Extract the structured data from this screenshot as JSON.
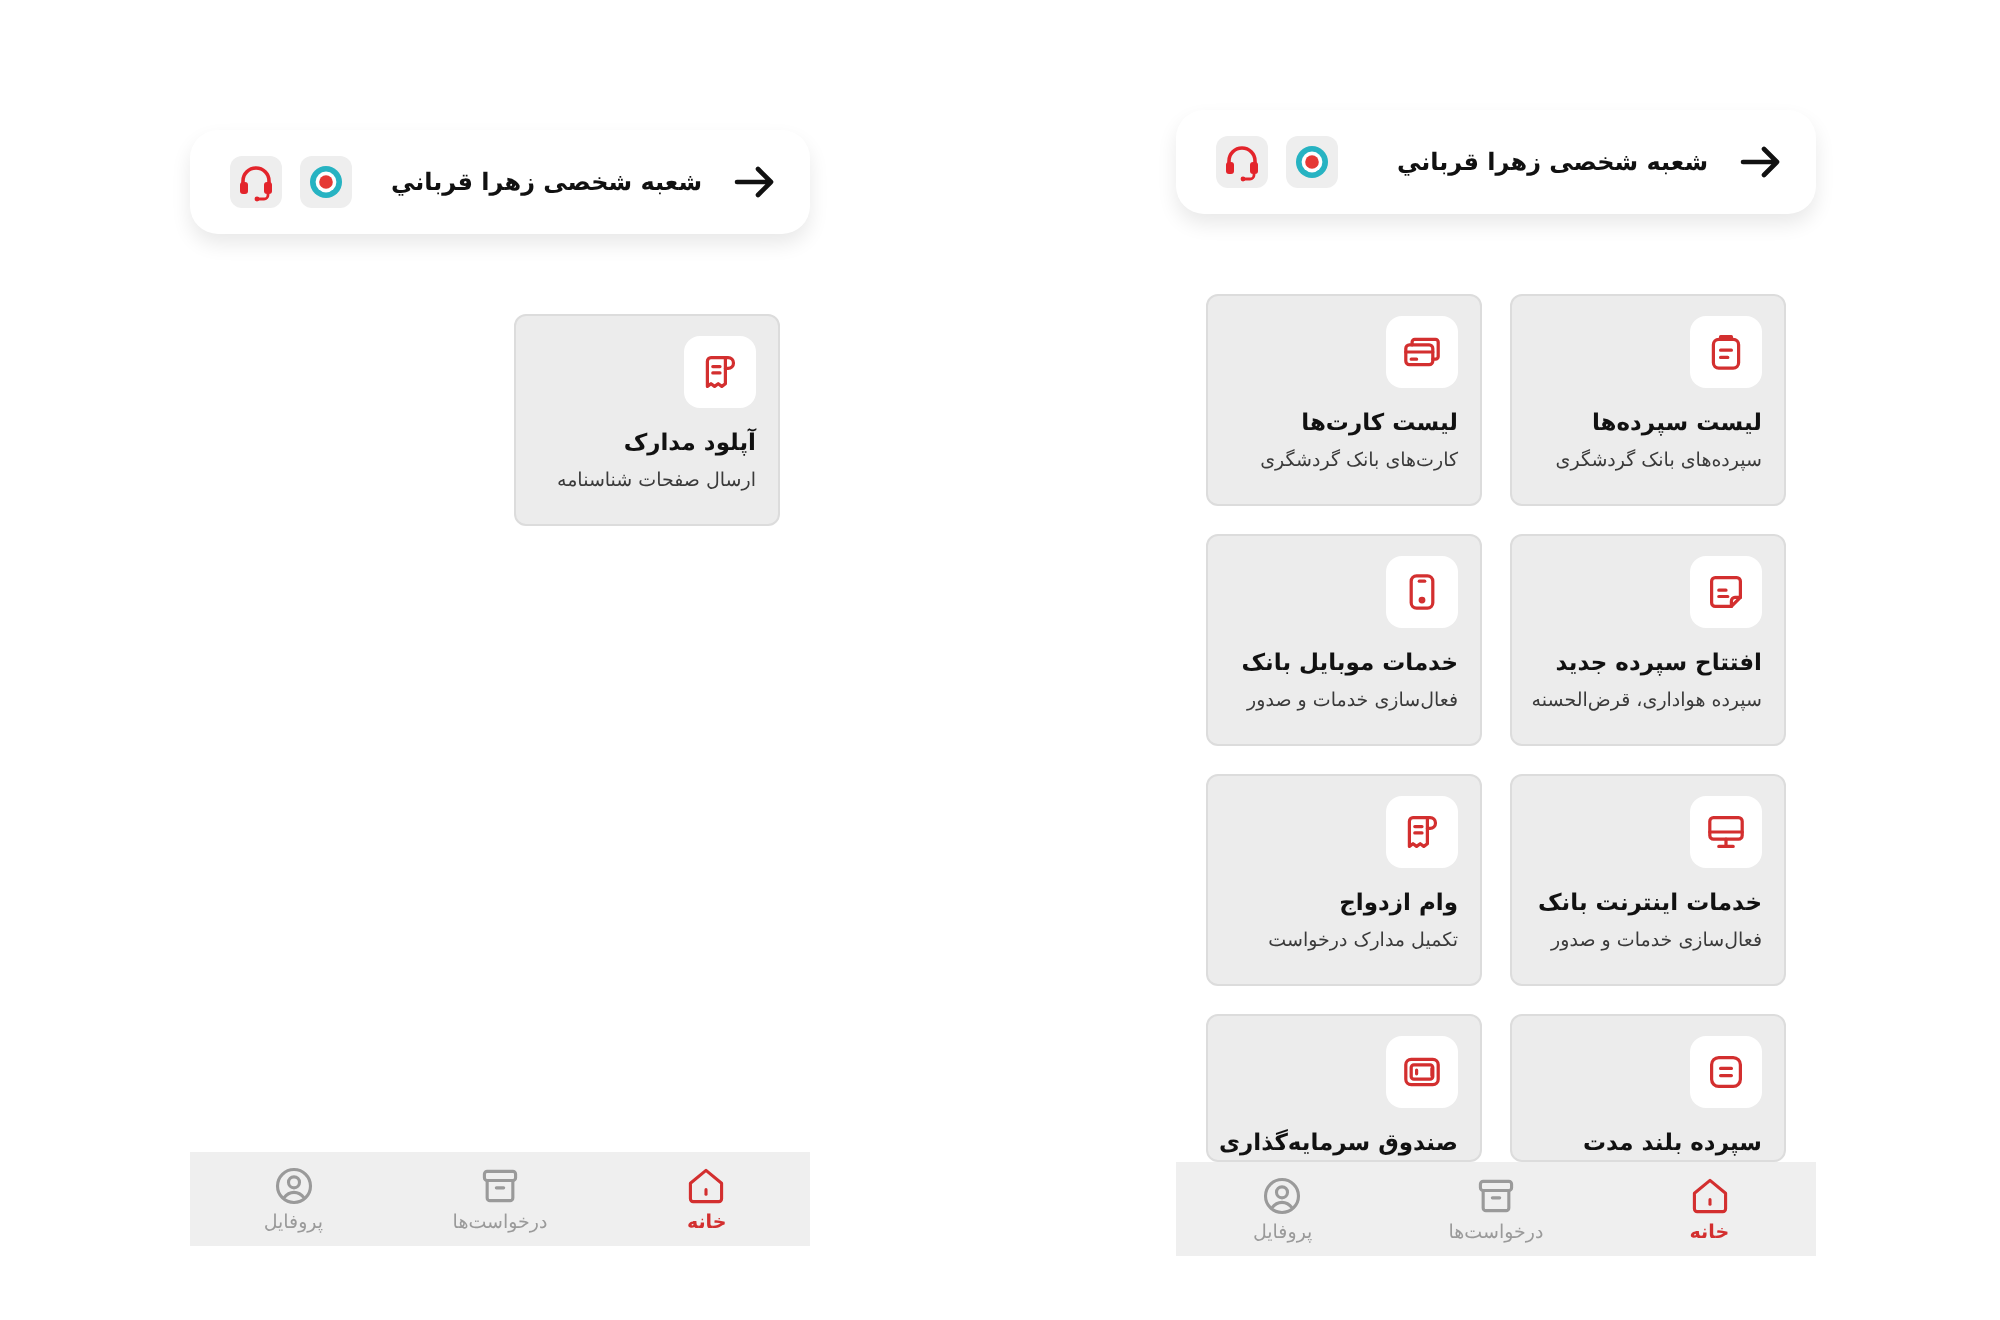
{
  "screens": [
    {
      "header": {
        "title": "شعبه شخصی زهرا قرباني"
      },
      "cards": [
        {
          "kind": "deposits",
          "title": "لیست سپرده‌ها",
          "description": "سپرده‌های بانک گردشگری"
        },
        {
          "kind": "cards",
          "title": "لیست کارت‌ها",
          "description": "کارت‌های بانک گردشگری"
        },
        {
          "kind": "opening",
          "title": "افتتاح سپرده جدید",
          "description": "سپرده هواداری، قرض‌الحسنه"
        },
        {
          "kind": "mobile",
          "title": "خدمات موبایل بانک",
          "description": "فعال‌سازی خدمات و صدور"
        },
        {
          "kind": "internet",
          "title": "خدمات اینترنت بانک",
          "description": "فعال‌سازی خدمات و صدور"
        },
        {
          "kind": "loan",
          "title": "وام ازدواج",
          "description": "تکمیل مدارک درخواست"
        },
        {
          "kind": "term",
          "title": "سپرده بلند مدت"
        },
        {
          "kind": "fund",
          "title": "صندوق سرمایه‌گذاری"
        }
      ],
      "nav": [
        {
          "kind": "home",
          "label": "خانه",
          "selected": true
        },
        {
          "kind": "requests",
          "label": "درخواست‌ها",
          "selected": false
        },
        {
          "kind": "profile",
          "label": "پروفایل",
          "selected": false
        }
      ]
    },
    {
      "header": {
        "title": "شعبه شخصی زهرا قرباني"
      },
      "cards": [
        {
          "kind": "upload",
          "title": "آپلود مدارک",
          "description": "ارسال صفحات شناسنامه"
        }
      ],
      "nav": [
        {
          "kind": "home",
          "label": "خانه",
          "selected": true
        },
        {
          "kind": "requests",
          "label": "درخواست‌ها",
          "selected": false
        },
        {
          "kind": "profile",
          "label": "پروفایل",
          "selected": false
        }
      ]
    }
  ]
}
